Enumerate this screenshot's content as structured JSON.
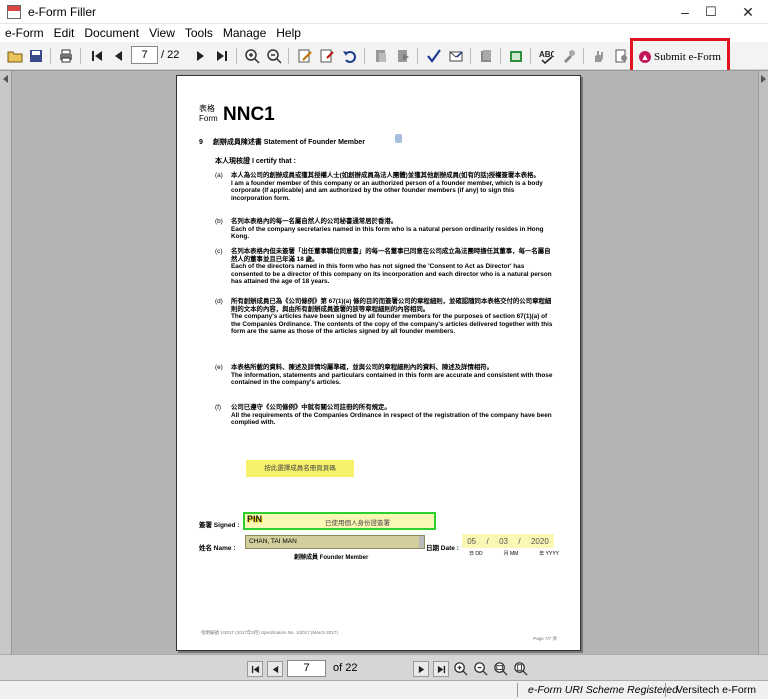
{
  "window": {
    "title": "e-Form Filler",
    "minimize": "–",
    "maximize": "☐",
    "close": "✕"
  },
  "menu": [
    "e-Form",
    "Edit",
    "Document",
    "View",
    "Tools",
    "Manage",
    "Help"
  ],
  "toolbar": {
    "current_page": "7",
    "total_pages": "/ 22",
    "submit_label": "Submit e-Form"
  },
  "form": {
    "label_zh": "表格",
    "label_en": "Form",
    "code": "NNC1",
    "section_number": "9",
    "section_title": "創辦成員陳述書 Statement of Founder Member",
    "certify": "本人現核證 I certify that :",
    "clauses": [
      {
        "label": "(a)",
        "zh": "本人為公司的創辦成員或獲其授權人士(如創辦成員為法人團體)並獲其他創辦成員(如有的話)授權簽署本表格。",
        "en": "I am a founder member of this company or an authorized person of a founder member, which is a body corporate (if applicable) and am authorized by the other founder members (if any) to sign this incorporation form."
      },
      {
        "label": "(b)",
        "zh": "名列本表格內的每一名屬自然人的公司秘書通常居於香港。",
        "en": "Each of the company secretaries named in this form who is a natural person ordinarily resides in Hong Kong."
      },
      {
        "label": "(c)",
        "zh": "名列本表格內但未簽署「出任董事職位同意書」的每一名董事已同意在公司成立為法團時擔任其董事，每一名屬自然人的董事並且已年滿 18 歲。",
        "en": "Each of the directors named in this form who has not signed the 'Consent to Act as Director' has consented to be a director of this company on its incorporation and each director who is a natural person has attained the age of 18 years."
      },
      {
        "label": "(d)",
        "zh": "所有創辦成員已為《公司條例》第 67(1)(a) 條的目的而簽署公司的章程細則，並確認隨同本表格交付的公司章程細則的文本的內容，與由所有創辦成員簽署的該等章程細則的內容相同。",
        "en": "The company's articles have been signed by all founder members for the purposes of section 67(1)(a) of the Companies Ordinance. The contents of the copy of the company's articles delivered together with this form are the same as those of the articles signed by all founder members."
      },
      {
        "label": "(e)",
        "zh": "本表格所載的資料、陳述及詳情均屬準確，並與公司的章程細則內的資料、陳述及詳情相符。",
        "en": "The information, statements and particulars contained in this form are accurate and consistent with those contained in the company's articles."
      },
      {
        "label": "(f)",
        "zh": "公司已遵守《公司條例》中就有關公司註冊的所有規定。",
        "en": "All the requirements of the Companies Ordinance in respect of the registration of the company have been complied with."
      }
    ],
    "yellow_note": "按此選擇成員名冊頁頁碼",
    "signed_label": "簽署 Signed :",
    "pin": "PIN",
    "sign_hint": "已使用個人身份證簽署",
    "name_label": "姓名 Name :",
    "name_value": "CHAN, TAI MAN",
    "founder_caption": "創辦成員 Founder Member",
    "date_label": "日期 Date :",
    "date_dd": "05",
    "date_mm": "03",
    "date_yyyy": "2020",
    "date_sep": "/",
    "date_cap_dd": "日 DD",
    "date_cap_mm": "月 MM",
    "date_cap_yyyy": "年 YYYY",
    "footer_left": "指明編號 1/2017 (2017年3月) Specification No. 1/2017 (March 2017)",
    "footer_right": "Page 7/7 頁"
  },
  "nav": {
    "current_page": "7",
    "total": "of 22"
  },
  "status": {
    "scheme": "e-Form URI Scheme Registered",
    "vendor": "Versitech e-Form"
  }
}
